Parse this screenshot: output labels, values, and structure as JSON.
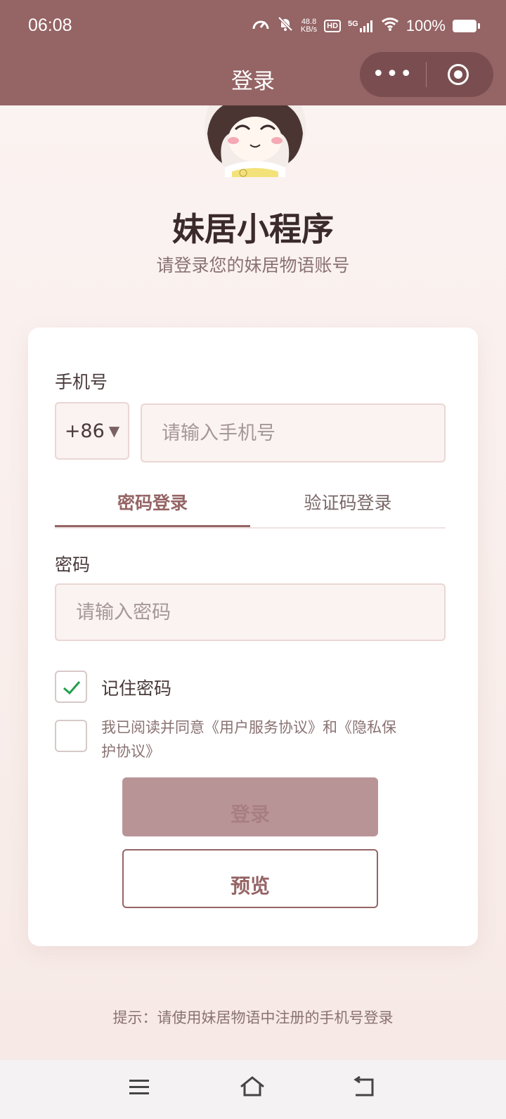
{
  "status_bar": {
    "time": "06:08",
    "net_speed_value": "48.8",
    "net_speed_unit": "KB/s",
    "hd_label": "HD",
    "network_label": "5G",
    "battery": "100%"
  },
  "navbar": {
    "title": "登录",
    "more_label": "•••"
  },
  "header": {
    "app_title": "妹居小程序",
    "subtitle": "请登录您的妹居物语账号"
  },
  "form": {
    "phone_label": "手机号",
    "country_code": "+86",
    "country_arrow": "▼",
    "phone_placeholder": "请输入手机号",
    "tabs": [
      {
        "label": "密码登录",
        "active": true
      },
      {
        "label": "验证码登录",
        "active": false
      }
    ],
    "password_label": "密码",
    "password_placeholder": "请输入密码",
    "remember_label": "记住密码",
    "remember_checked": true,
    "agree_text": "我已阅读并同意《用户服务协议》和《隐私保护协议》",
    "agree_checked": false,
    "login_button": "登录",
    "preview_button": "预览"
  },
  "footer": {
    "tip": "提示：请使用妹居物语中注册的手机号登录"
  },
  "colors": {
    "accent": "#956465",
    "login_disabled": "#b99497",
    "check_green": "#22a04a"
  },
  "icons": [
    "speedometer-icon",
    "bell-off-icon",
    "hd-icon",
    "signal-icon",
    "wifi-icon",
    "battery-icon",
    "more-icon",
    "target-icon",
    "menu-icon",
    "home-icon",
    "back-icon",
    "check-icon"
  ]
}
